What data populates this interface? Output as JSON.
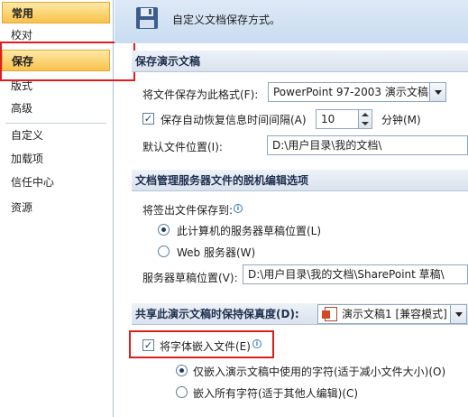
{
  "sidebar": {
    "items": [
      {
        "label": "常用"
      },
      {
        "label": "校对"
      },
      {
        "label": "保存"
      },
      {
        "label": "版式"
      },
      {
        "label": "高级"
      },
      {
        "label": "自定义"
      },
      {
        "label": "加载项"
      },
      {
        "label": "信任中心"
      },
      {
        "label": "资源"
      }
    ]
  },
  "header": {
    "title": "自定义文档保存方式。",
    "icon": "save-disk-icon"
  },
  "save_section": {
    "title": "保存演示文稿",
    "format_label": "将文件保存为此格式(F):",
    "format_value": "PowerPoint 97-2003 演示文稿",
    "autosave_label": "保存自动恢复信息时间间隔(A)",
    "autosave_checked": true,
    "autosave_value": "10",
    "autosave_unit": "分钟(M)",
    "default_location_label": "默认文件位置(I):",
    "default_location_value": "D:\\用户目录\\我的文档\\"
  },
  "offline_section": {
    "title": "文档管理服务器文件的脱机编辑选项",
    "checkout_label": "将签出文件保存到:",
    "option_local": "此计算机的服务器草稿位置(L)",
    "option_web": "Web 服务器(W)",
    "drafts_label": "服务器草稿位置(V):",
    "drafts_value": "D:\\用户目录\\我的文档\\SharePoint 草稿\\"
  },
  "fidelity_section": {
    "title": "共享此演示文稿时保持保真度(D):",
    "doc_value": "演示文稿1 [兼容模式]",
    "embed_fonts_label": "将字体嵌入文件(E)",
    "embed_fonts_checked": true,
    "option_used_chars": "仅嵌入演示文稿中使用的字符(适于减小文件大小)(O)",
    "option_all_chars": "嵌入所有字符(适于其他人编辑)(C)"
  },
  "colors": {
    "highlight": "#e01d1d",
    "active_nav": "#f9c24a"
  }
}
